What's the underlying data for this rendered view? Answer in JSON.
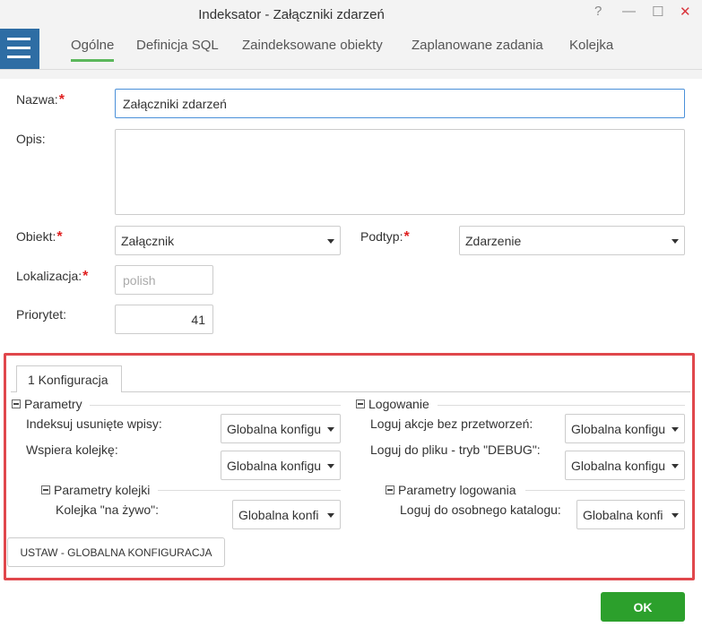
{
  "window": {
    "title": "Indeksator - Załączniki zdarzeń",
    "help": "?",
    "minimize": "—",
    "maximize": "☐",
    "close": "✕"
  },
  "tabs": [
    "Ogólne",
    "Definicja SQL",
    "Zaindeksowane obiekty",
    "Zaplanowane zadania",
    "Kolejka"
  ],
  "form": {
    "name_label": "Nazwa:",
    "name_value": "Załączniki zdarzeń",
    "desc_label": "Opis:",
    "desc_value": "",
    "object_label": "Obiekt:",
    "object_value": "Załącznik",
    "subtype_label": "Podtyp:",
    "subtype_value": "Zdarzenie",
    "locale_label": "Lokalizacja:",
    "locale_value": "polish",
    "priority_label": "Priorytet:",
    "priority_value": "41",
    "required_mark": "*"
  },
  "config": {
    "tab_label": "1  Konfiguracja",
    "params": {
      "title": "Parametry",
      "index_deleted_label": "Indeksuj usunięte wpisy:",
      "index_deleted_value": "Globalna konfigu",
      "supports_queue_label": "Wspiera kolejkę:",
      "supports_queue_value": "Globalna konfigu",
      "queue_params_title": "Parametry kolejki",
      "live_queue_label": "Kolejka \"na żywo\":",
      "live_queue_value": "Globalna konfi"
    },
    "logging": {
      "title": "Logowanie",
      "log_noproc_label": "Loguj akcje bez przetworzeń:",
      "log_noproc_value": "Globalna konfigu",
      "log_file_label": "Loguj do pliku - tryb \"DEBUG\":",
      "log_file_value": "Globalna konfigu",
      "log_params_title": "Parametry logowania",
      "log_dir_label": "Loguj do osobnego katalogu:",
      "log_dir_value": "Globalna konfi"
    },
    "set_global_button": "USTAW - GLOBALNA KONFIGURACJA"
  },
  "ok_button": "OK",
  "colors": {
    "accent_green": "#5cb85c",
    "ok_green": "#2ca02c",
    "menu_blue": "#2e6da4",
    "highlight_red": "#e0474c",
    "required_red": "#e02020"
  }
}
